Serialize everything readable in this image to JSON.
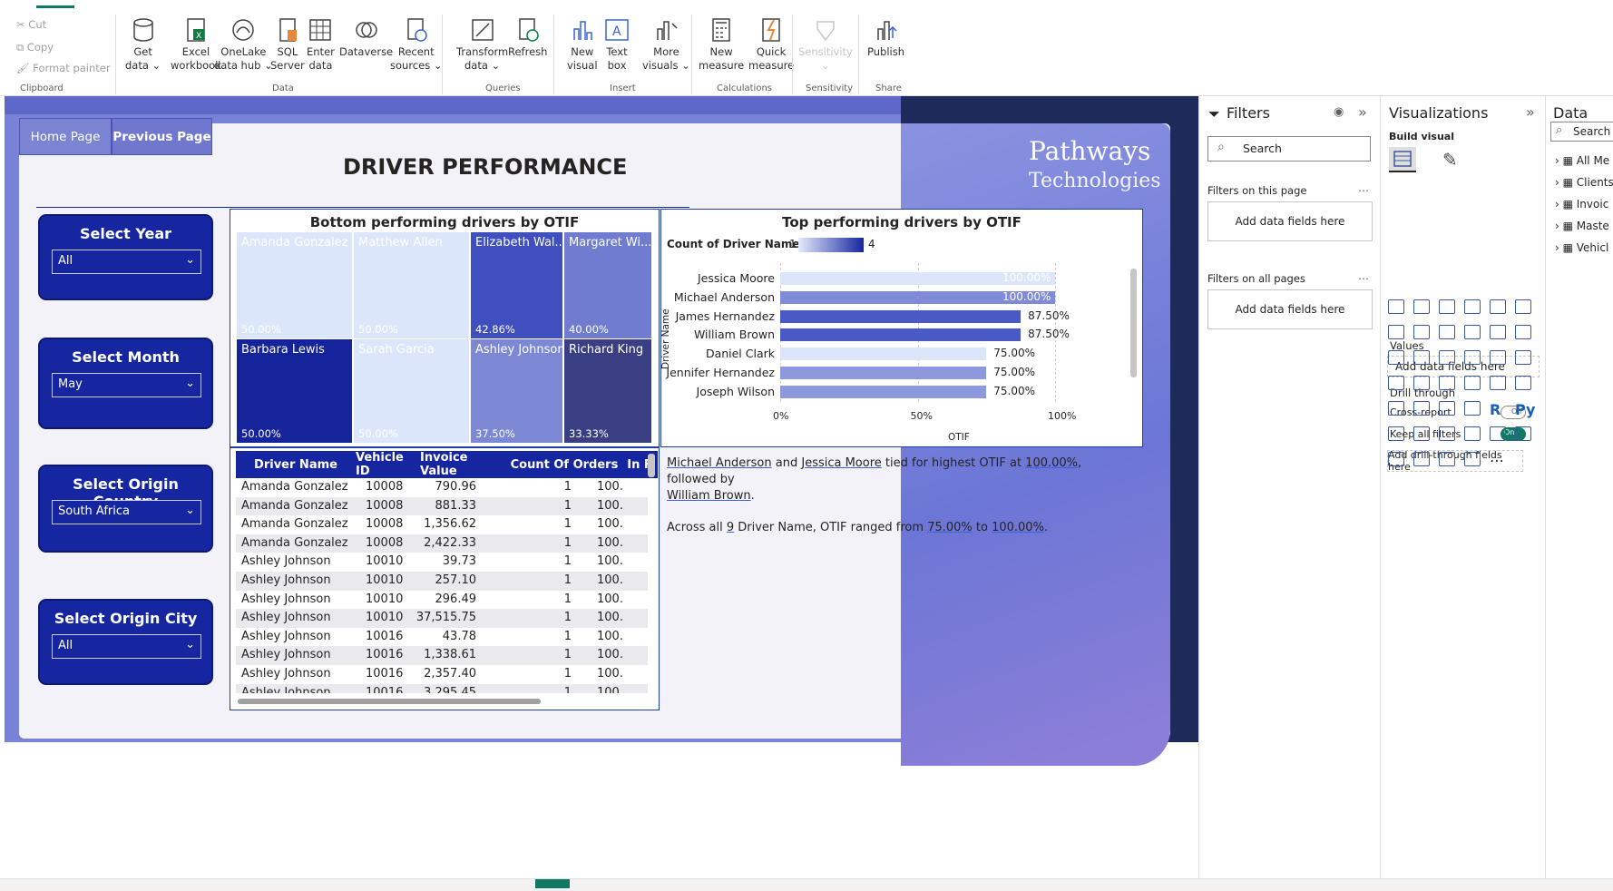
{
  "ribbon": {
    "clipboard": {
      "cut": "Cut",
      "copy": "Copy",
      "format_painter": "Format painter",
      "group": "Clipboard"
    },
    "data_group": {
      "group": "Data",
      "get_data": "Get\ndata ⌄",
      "excel": "Excel\nworkbook",
      "onelake": "OneLake\ndata hub ⌄",
      "sql": "SQL\nServer",
      "enter": "Enter\ndata",
      "dataverse": "Dataverse",
      "recent": "Recent\nsources ⌄"
    },
    "queries": {
      "group": "Queries",
      "transform": "Transform\ndata ⌄",
      "refresh": "Refresh"
    },
    "insert": {
      "group": "Insert",
      "new_visual": "New\nvisual",
      "text_box": "Text\nbox",
      "more_visuals": "More\nvisuals ⌄"
    },
    "calculations": {
      "group": "Calculations",
      "new_measure": "New\nmeasure",
      "quick_measure": "Quick\nmeasure"
    },
    "sensitivity": {
      "group": "Sensitivity",
      "label": "Sensitivity\n⌄"
    },
    "share": {
      "group": "Share",
      "publish": "Publish"
    }
  },
  "nav": {
    "home": "Home Page",
    "previous": "Previous Page"
  },
  "report": {
    "title": "DRIVER PERFORMANCE",
    "brand_line1": "Pathways",
    "brand_line2": "Technologies"
  },
  "slicers": [
    {
      "label": "Select Year",
      "value": "All"
    },
    {
      "label": "Select Month",
      "value": "May"
    },
    {
      "label": "Select Origin Country",
      "value": "South Africa"
    },
    {
      "label": "Select Origin City",
      "value": "All"
    }
  ],
  "treemap": {
    "title": "Bottom performing drivers by OTIF",
    "cells": [
      {
        "name": "Amanda Gonzalez",
        "pct": "50.00%",
        "color": "#dbe6fb",
        "text": "#ffffff"
      },
      {
        "name": "Matthew Allen",
        "pct": "50.00%",
        "color": "#dbe6fb",
        "text": "#ffffff"
      },
      {
        "name": "Elizabeth Wal...",
        "pct": "42.86%",
        "color": "#3f4fbd",
        "text": "#ffffff"
      },
      {
        "name": "Margaret Wi...",
        "pct": "40.00%",
        "color": "#6f7ccf",
        "text": "#ffffff"
      },
      {
        "name": "Barbara Lewis",
        "pct": "50.00%",
        "color": "#15249a",
        "text": "#ffffff"
      },
      {
        "name": "Sarah Garcia",
        "pct": "50.00%",
        "color": "#dbe6fb",
        "text": "#ffffff"
      },
      {
        "name": "Ashley Johnson",
        "pct": "37.50%",
        "color": "#7d88d4",
        "text": "#ffffff"
      },
      {
        "name": "Richard King",
        "pct": "33.33%",
        "color": "#3a3f84",
        "text": "#ffffff"
      }
    ]
  },
  "table": {
    "headers": [
      "Driver Name",
      "Vehicle ID",
      "Invoice Value",
      "Count Of Orders",
      "In F"
    ],
    "rows": [
      [
        "Amanda Gonzalez",
        "10008",
        "790.96",
        "1",
        "100."
      ],
      [
        "Amanda Gonzalez",
        "10008",
        "881.33",
        "1",
        "100."
      ],
      [
        "Amanda Gonzalez",
        "10008",
        "1,356.62",
        "1",
        "100."
      ],
      [
        "Amanda Gonzalez",
        "10008",
        "2,422.33",
        "1",
        "100."
      ],
      [
        "Ashley Johnson",
        "10010",
        "39.73",
        "1",
        "100."
      ],
      [
        "Ashley Johnson",
        "10010",
        "257.10",
        "1",
        "100."
      ],
      [
        "Ashley Johnson",
        "10010",
        "296.49",
        "1",
        "100."
      ],
      [
        "Ashley Johnson",
        "10010",
        "37,515.75",
        "1",
        "100."
      ],
      [
        "Ashley Johnson",
        "10016",
        "43.78",
        "1",
        "100."
      ],
      [
        "Ashley Johnson",
        "10016",
        "1,338.61",
        "1",
        "100."
      ],
      [
        "Ashley Johnson",
        "10016",
        "2,357.40",
        "1",
        "100."
      ],
      [
        "Ashley Johnson",
        "10016",
        "3,295.45",
        "1",
        "100."
      ]
    ]
  },
  "chart_data": {
    "type": "bar",
    "title": "Top performing drivers by OTIF",
    "legend_title": "Count of Driver Name",
    "legend_min": "1",
    "legend_max": "4",
    "ylabel": "Driver Name",
    "xlabel": "OTIF",
    "xticks": [
      "0%",
      "50%",
      "100%"
    ],
    "xlim": [
      0,
      100
    ],
    "categories": [
      "Jessica Moore",
      "Michael Anderson",
      "James Hernandez",
      "William Brown",
      "Daniel Clark",
      "Jennifer Hernandez",
      "Joseph Wilson"
    ],
    "values": [
      100,
      100,
      87.5,
      87.5,
      75,
      75,
      75
    ],
    "labels": [
      "100.00%",
      "100.00%",
      "87.50%",
      "87.50%",
      "75.00%",
      "75.00%",
      "75.00%"
    ],
    "colors": [
      "#dbe6fb",
      "#7f8ad8",
      "#4a5ac4",
      "#4a5ac4",
      "#dbe6fb",
      "#8e98dc",
      "#8e98dc"
    ]
  },
  "narrative": {
    "p1_a": "Michael Anderson",
    "p1_b": " and ",
    "p1_c": "Jessica Moore",
    "p1_d": " tied for highest OTIF at ",
    "p1_e": "100.00%",
    "p1_f": ", followed by",
    "p1_g": "William Brown",
    "p1_h": ".",
    "p2_a": "Across all ",
    "p2_b": "9",
    "p2_c": " Driver Name, OTIF ranged from ",
    "p2_d": "75.00%",
    "p2_e": " to ",
    "p2_f": "100.00%",
    "p2_g": "."
  },
  "filters_pane": {
    "title": "Filters",
    "search": "Search",
    "on_page": "Filters on this page",
    "add1": "Add data fields here",
    "all_pages": "Filters on all pages",
    "add2": "Add data fields here"
  },
  "viz_pane": {
    "title": "Visualizations",
    "build": "Build visual",
    "values": "Values",
    "add_values": "Add data fields here",
    "drill": "Drill through",
    "cross": "Cross-report",
    "cross_state": "Off",
    "keep": "Keep all filters",
    "keep_state": "On",
    "add_drill": "Add drill-through fields here",
    "r": "R",
    "py": "Py"
  },
  "data_pane": {
    "title": "Data",
    "search": "Search",
    "items": [
      "All Me",
      "Clients",
      "Invoic",
      "Maste",
      "Vehicl"
    ]
  }
}
